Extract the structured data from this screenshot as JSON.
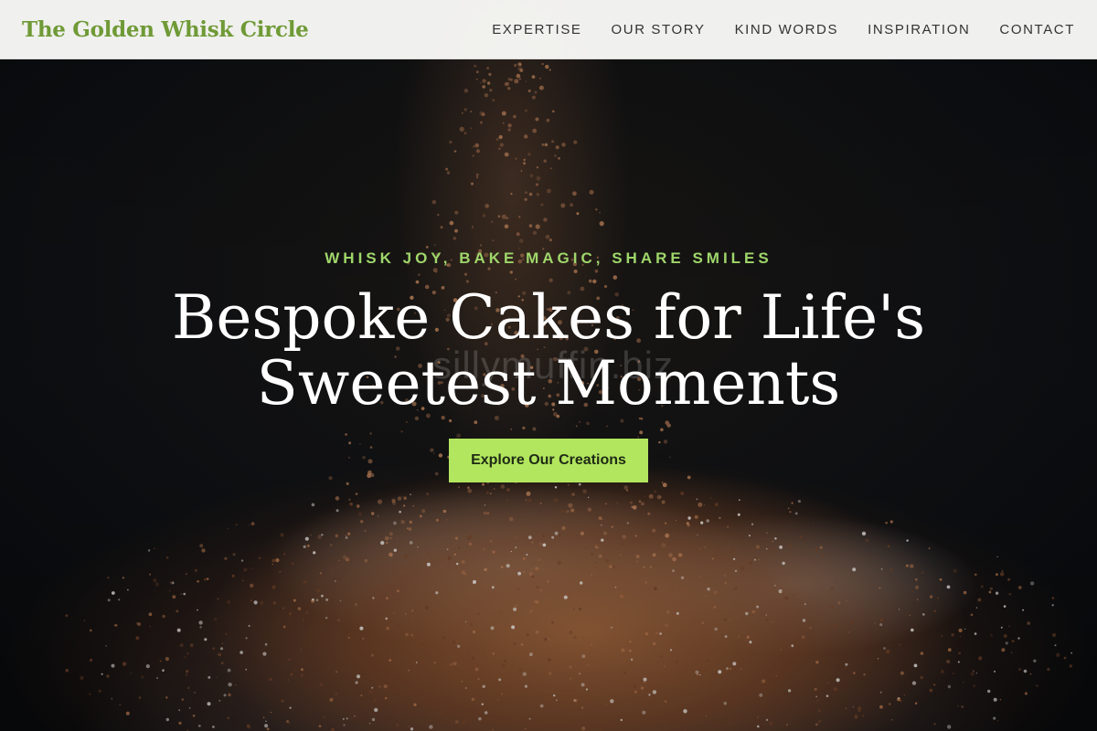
{
  "header": {
    "brand": "The Golden Whisk Circle",
    "nav": [
      {
        "label": "EXPERTISE"
      },
      {
        "label": "OUR STORY"
      },
      {
        "label": "KIND WORDS"
      },
      {
        "label": "INSPIRATION"
      },
      {
        "label": "CONTACT"
      }
    ]
  },
  "hero": {
    "tagline": "WHISK JOY, BAKE MAGIC, SHARE SMILES",
    "headline_line1": "Bespoke Cakes for Life's",
    "headline_line2": "Sweetest Moments",
    "watermark": "sillymuffin.biz",
    "cta_label": "Explore Our Creations",
    "background_image": "cocoa-powder-dusting-cake"
  },
  "colors": {
    "brand": "#6f9a36",
    "accent": "#b2e65e",
    "tagline": "#9fd66a"
  }
}
